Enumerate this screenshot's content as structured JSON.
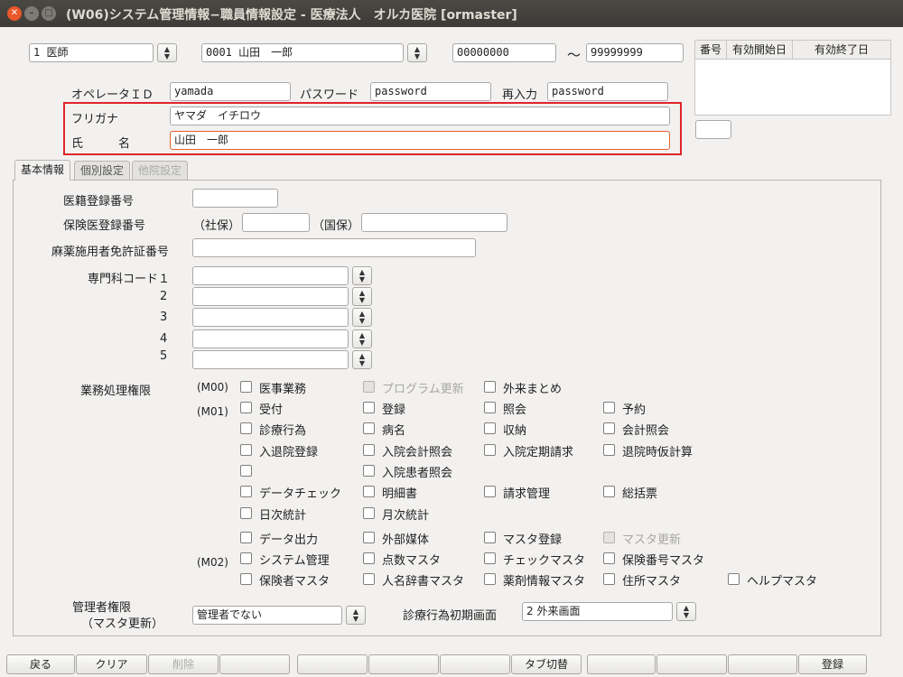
{
  "window": {
    "title": "(W06)システム管理情報−職員情報設定 - 医療法人　オルカ医院 [ormaster]"
  },
  "header": {
    "job_type": "1 医師",
    "staff": "0001 山田　一郎",
    "range_from": "00000000",
    "tilde": "〜",
    "range_to": "99999999",
    "operator_id_label": "オペレータＩＤ",
    "operator_id": "yamada",
    "password_label": "パスワード",
    "password": "password",
    "reenter_label": "再入力",
    "reenter": "password",
    "kana_label": "フリガナ",
    "kana": "ヤマダ　イチロウ",
    "name_label": "氏　　　名",
    "name": "山田　一郎"
  },
  "table": {
    "headers": [
      "番号",
      "有効開始日",
      "有効終了日"
    ]
  },
  "tabs": [
    {
      "label": "基本情報",
      "state": "active"
    },
    {
      "label": "個別設定",
      "state": "inactive"
    },
    {
      "label": "他院設定",
      "state": "disabled"
    }
  ],
  "basic": {
    "reg_no_label": "医籍登録番号",
    "insurance_label": "保険医登録番号",
    "shaho_label": "（社保）",
    "kokuho_label": "（国保）",
    "narcotic_label": "麻薬施用者免許証番号",
    "specialty_label": "専門科コード１",
    "specialty_nums": [
      "2",
      "3",
      "4",
      "5"
    ],
    "auth_label": "業務処理権限",
    "admin_label_1": "管理者権限",
    "admin_label_2": "（マスタ更新）",
    "admin_value": "管理者でない",
    "initial_screen_label": "診療行為初期画面",
    "initial_screen_value": "2 外来画面"
  },
  "groups": [
    "(M00)",
    "(M01)",
    "(M02)"
  ],
  "checks": [
    {
      "label": "医事業務",
      "disabled": false
    },
    {
      "label": "プログラム更新",
      "disabled": true
    },
    {
      "label": "外来まとめ",
      "disabled": false
    },
    {
      "label": "受付",
      "disabled": false
    },
    {
      "label": "登録",
      "disabled": false
    },
    {
      "label": "照会",
      "disabled": false
    },
    {
      "label": "予約",
      "disabled": false
    },
    {
      "label": "診療行為",
      "disabled": false
    },
    {
      "label": "病名",
      "disabled": false
    },
    {
      "label": "収納",
      "disabled": false
    },
    {
      "label": "会計照会",
      "disabled": false
    },
    {
      "label": "入退院登録",
      "disabled": false
    },
    {
      "label": "入院会計照会",
      "disabled": false
    },
    {
      "label": "入院定期請求",
      "disabled": false
    },
    {
      "label": "退院時仮計算",
      "disabled": false
    },
    {
      "label": "",
      "disabled": false
    },
    {
      "label": "入院患者照会",
      "disabled": false
    },
    {
      "label": "データチェック",
      "disabled": false
    },
    {
      "label": "明細書",
      "disabled": false
    },
    {
      "label": "請求管理",
      "disabled": false
    },
    {
      "label": "総括票",
      "disabled": false
    },
    {
      "label": "日次統計",
      "disabled": false
    },
    {
      "label": "月次統計",
      "disabled": false
    },
    {
      "label": "データ出力",
      "disabled": false
    },
    {
      "label": "外部媒体",
      "disabled": false
    },
    {
      "label": "マスタ登録",
      "disabled": false
    },
    {
      "label": "マスタ更新",
      "disabled": true
    },
    {
      "label": "システム管理",
      "disabled": false
    },
    {
      "label": "点数マスタ",
      "disabled": false
    },
    {
      "label": "チェックマスタ",
      "disabled": false
    },
    {
      "label": "保険番号マスタ",
      "disabled": false
    },
    {
      "label": "保険者マスタ",
      "disabled": false
    },
    {
      "label": "人名辞書マスタ",
      "disabled": false
    },
    {
      "label": "薬剤情報マスタ",
      "disabled": false
    },
    {
      "label": "住所マスタ",
      "disabled": false
    },
    {
      "label": "ヘルプマスタ",
      "disabled": false
    }
  ],
  "footer": {
    "buttons": [
      {
        "label": "戻る",
        "disabled": false
      },
      {
        "label": "クリア",
        "disabled": false
      },
      {
        "label": "削除",
        "disabled": true
      },
      {
        "label": "",
        "disabled": false
      },
      {
        "label": "",
        "disabled": false
      },
      {
        "label": "",
        "disabled": false
      },
      {
        "label": "",
        "disabled": false
      },
      {
        "label": "タブ切替",
        "disabled": false
      },
      {
        "label": "",
        "disabled": false
      },
      {
        "label": "",
        "disabled": false
      },
      {
        "label": "",
        "disabled": false
      },
      {
        "label": "登録",
        "disabled": false
      }
    ]
  }
}
